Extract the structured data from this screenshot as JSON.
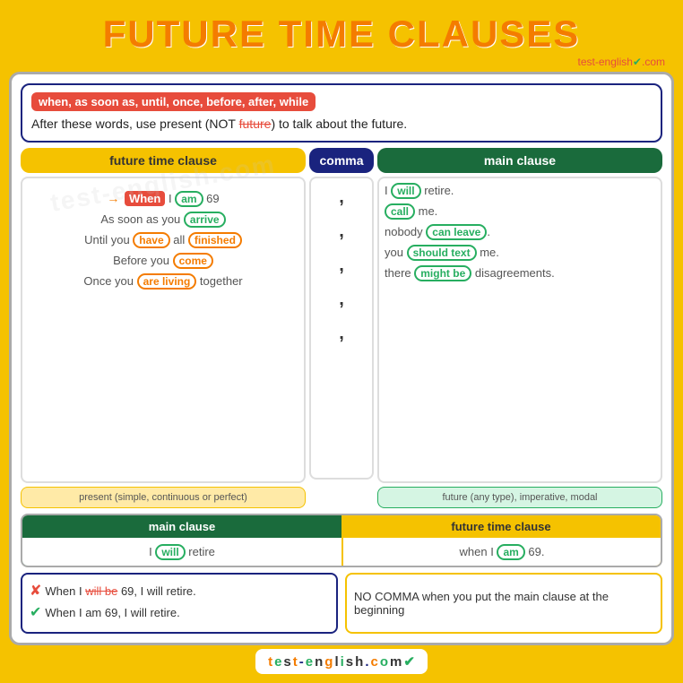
{
  "title": "FUTURE TIME CLAUSES",
  "site": "test-english",
  "site_tld": ".com",
  "rule_keywords": "when, as soon as, until, once, before, after, while",
  "rule_text_1": "After these words, use present (NOT",
  "rule_text_future": "future",
  "rule_text_2": ") to talk about the future.",
  "col_left_header": "future time clause",
  "col_comma_header": "comma",
  "col_right_header": "main clause",
  "rows": [
    {
      "left": "When I am 69",
      "left_tagged": true,
      "comma": ",",
      "right": "I will retire."
    },
    {
      "left": "As soon as you arrive",
      "comma": ",",
      "right": "call me."
    },
    {
      "left": "Until you have all finished",
      "comma": ",",
      "right": "nobody can leave."
    },
    {
      "left": "Before you come",
      "comma": ",",
      "right": "you should text me."
    },
    {
      "left": "Once you are living together",
      "comma": ",",
      "right": "there might be disagreements."
    }
  ],
  "label_left": "present (simple, continuous or perfect)",
  "label_right": "future (any type), imperative, modal",
  "bottom_main_header": "main clause",
  "bottom_main_content": "I will retire",
  "bottom_future_header": "future time clause",
  "bottom_future_content": "when I am 69.",
  "example_wrong": "When I will be 69, I will retire.",
  "example_correct": "When I am 69, I will retire.",
  "no_comma_text": "NO COMMA when you put the main clause at the beginning",
  "footer_letters": [
    "t",
    "e",
    "s",
    "t",
    "-",
    "e",
    "n",
    "g",
    "l",
    "i",
    "s",
    "h",
    ".",
    "c",
    "o",
    "m"
  ]
}
